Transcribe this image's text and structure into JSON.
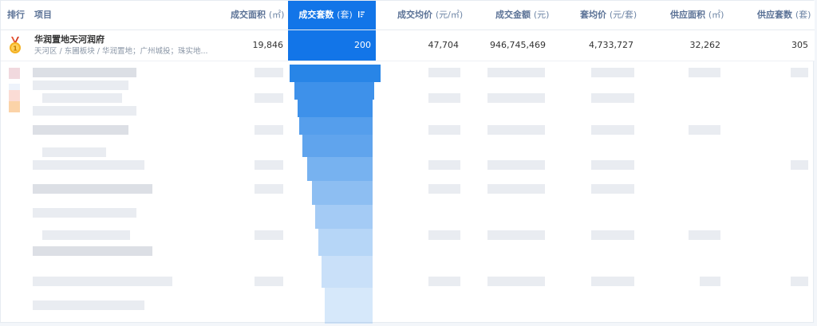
{
  "header": {
    "rank": "排行",
    "project": "项目",
    "area": {
      "label": "成交面积",
      "unit": "(㎡)"
    },
    "units": {
      "label": "成交套数",
      "unit": "(套)"
    },
    "avg_price": {
      "label": "成交均价",
      "unit": "(元/㎡)"
    },
    "amount": {
      "label": "成交金额",
      "unit": "(元)"
    },
    "avg_unit_price": {
      "label": "套均价",
      "unit": "(元/套)"
    },
    "supply_area": {
      "label": "供应面积",
      "unit": "(㎡)"
    },
    "supply_units": {
      "label": "供应套数",
      "unit": "(套)"
    }
  },
  "rows": [
    {
      "rank_icon": "gold-medal-icon",
      "name": "华润置地天河润府",
      "sub": "天河区 / 东圃板块 / 华润置地；广州城投；珠实地...",
      "area": "19,846",
      "units": "200",
      "avg_price": "47,704",
      "amount": "946,745,469",
      "avg_unit_price": "4,733,727",
      "supply_area": "32,262",
      "supply_units": "305"
    }
  ],
  "colors": {
    "accent": "#1275e8",
    "header_text": "#5b7296",
    "gold": "#f5b223"
  }
}
